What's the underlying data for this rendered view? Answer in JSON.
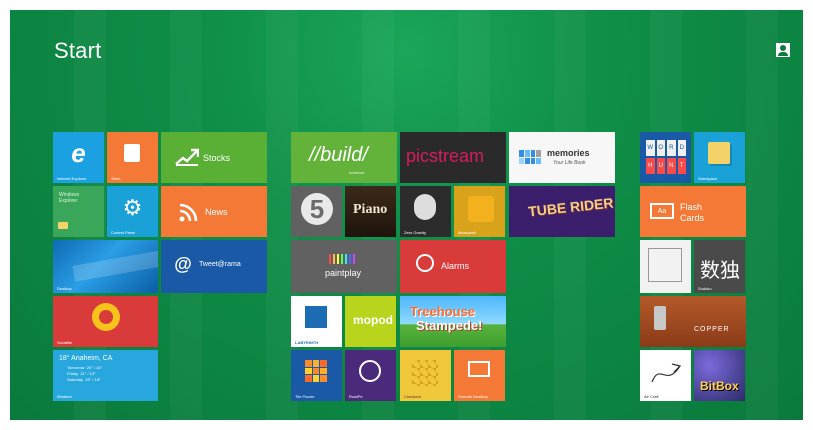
{
  "start": {
    "title": "Start"
  },
  "tiles": {
    "ie": {
      "label": "Internet Explorer"
    },
    "store": {
      "label": "Store"
    },
    "stocks": {
      "label": "Stocks"
    },
    "windows_explorer": {
      "label": "Windows Explorer"
    },
    "control_panel": {
      "label": "Control Panel"
    },
    "news": {
      "label": "News"
    },
    "desktop": {
      "label": "Desktop"
    },
    "tweet": {
      "label": "Tweet@rama"
    },
    "socialite": {
      "label": "Socialite"
    },
    "weather": {
      "location": "18° Anaheim, CA",
      "forecast": [
        "Tomorrow  20° / 16°",
        "Friday  21° / 13°",
        "Saturday  25° / 18°"
      ],
      "label": "Weather"
    },
    "build": {
      "text": "//build/",
      "sub": "windows"
    },
    "picstream": {
      "text": "picstream"
    },
    "memories": {
      "title": "memories",
      "subtitle": "Your Life Book"
    },
    "five": {
      "text": "5"
    },
    "piano": {
      "text": "Piano"
    },
    "zero_gravity": {
      "label": "Zero Gravity"
    },
    "measureit": {
      "label": "Measureit"
    },
    "tube_rider": {
      "text": "TUBE RIDER"
    },
    "paintplay": {
      "text": "paintplay"
    },
    "alarms": {
      "label": "Alarms"
    },
    "labyrinth": {
      "label": "LABYRINTH"
    },
    "mopod": {
      "text": "mopod"
    },
    "treehouse": {
      "line1": "Treehouse",
      "line2": "Stampede!"
    },
    "tile_puzzle": {
      "label": "Tile Puzzle"
    },
    "rowi": {
      "label": "RowiFe"
    },
    "checkers": {
      "label": "Checkers"
    },
    "remote_desktop": {
      "label": "Remote Desktop"
    },
    "word_hunt": {
      "letters": [
        "W",
        "O",
        "R",
        "D",
        "H",
        "U",
        "N",
        "T"
      ]
    },
    "notespace": {
      "label": "Notespace"
    },
    "flash_cards": {
      "line1": "Flash",
      "line2": "Cards",
      "icon_text": "Aa"
    },
    "sudoku": {
      "text": "数独",
      "label": "Sudoku"
    },
    "copper": {
      "text": "COPPER"
    },
    "air_craft": {
      "label": "Air Craft"
    },
    "bitbox": {
      "text": "BitBox"
    }
  },
  "colors": {
    "background": "#0f8f48",
    "ie": "#1ba1e2",
    "store": "#f47836",
    "stocks": "#59b035",
    "explorer": "#3aa65a",
    "control": "#1aa1d8",
    "news": "#f47836",
    "desktop": "#1b8bd0",
    "tweet": "#1a59a6",
    "socialite": "#d93b3b",
    "weather": "#27a7de",
    "alarms": "#d93b3b",
    "flash": "#f47836"
  }
}
